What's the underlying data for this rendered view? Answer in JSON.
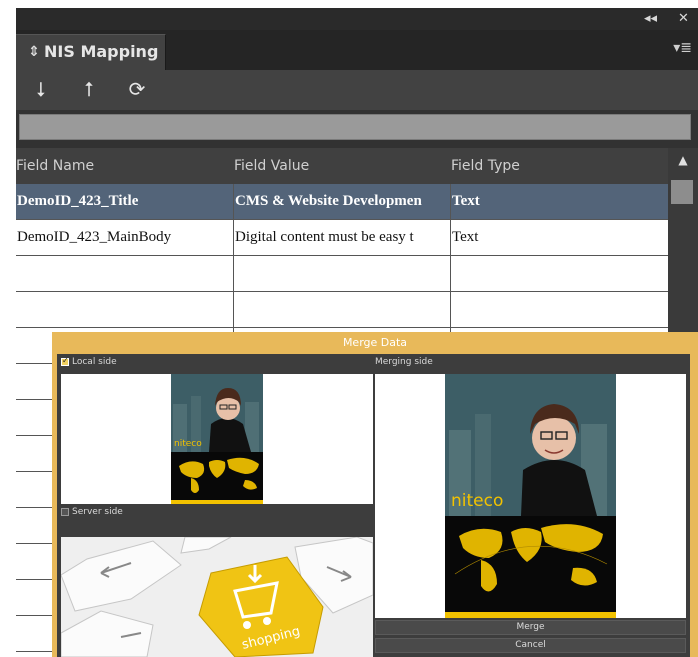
{
  "panel": {
    "title": "NIS Mapping",
    "collapse_glyph": "◂◂",
    "close_glyph": "✕",
    "menu_glyph": "▾≣",
    "tab_chevron": "⇕"
  },
  "toolbar": {
    "icons": [
      "arrow-down-icon",
      "arrow-up-icon",
      "refresh-icon"
    ],
    "glyphs": [
      "⭣",
      "⭡",
      "⟳"
    ]
  },
  "table": {
    "headers": [
      "Field Name",
      "Field Value",
      "Field Type"
    ],
    "rows": [
      [
        "DemoID_423_Title",
        "CMS & Website Developmen",
        "Text"
      ],
      [
        "DemoID_423_MainBody",
        "Digital content must be easy t",
        "Text"
      ]
    ]
  },
  "dialog": {
    "title": "Merge Data",
    "local_label": "Local side",
    "server_label": "Server side",
    "merging_label": "Merging side",
    "merge_button": "Merge",
    "cancel_button": "Cancel",
    "logo_text": "niteco",
    "shopping_text": "shopping"
  },
  "colors": {
    "accent": "#e8b95a",
    "selection": "#536479",
    "logo_yellow": "#f2c200"
  }
}
